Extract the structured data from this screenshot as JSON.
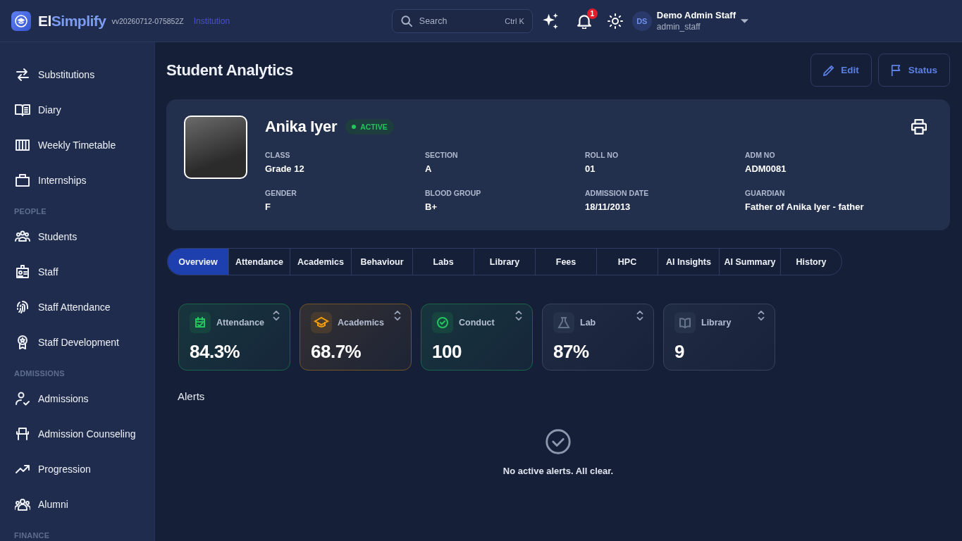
{
  "header": {
    "brand_lead": "El",
    "brand_rest": "Simplify",
    "version": "vv20260712-075852Z",
    "context": "Institution",
    "search": {
      "placeholder": "Search",
      "shortcut": "Ctrl K"
    },
    "notifications": {
      "count": "1"
    },
    "user": {
      "initials": "DS",
      "name": "Demo Admin Staff",
      "username": "admin_staff"
    }
  },
  "sidebar": {
    "sections": [
      {
        "items": [
          {
            "label": "Substitutions",
            "selected": false
          },
          {
            "label": "Diary",
            "selected": false
          },
          {
            "label": "Weekly Timetable",
            "selected": false
          },
          {
            "label": "Internships",
            "selected": false
          }
        ]
      },
      {
        "heading": "PEOPLE",
        "items": [
          {
            "label": "Students",
            "selected": false
          },
          {
            "label": "Staff",
            "selected": false
          },
          {
            "label": "Staff Attendance",
            "selected": false
          },
          {
            "label": "Staff Development",
            "selected": false
          }
        ]
      },
      {
        "heading": "ADMISSIONS",
        "items": [
          {
            "label": "Admissions",
            "selected": false
          },
          {
            "label": "Admission Counseling",
            "selected": false
          },
          {
            "label": "Progression",
            "selected": false
          },
          {
            "label": "Alumni",
            "selected": false
          }
        ]
      },
      {
        "heading": "FINANCE"
      }
    ]
  },
  "page": {
    "title": "Student Analytics",
    "actions": [
      {
        "label": "Edit"
      },
      {
        "label": "Status"
      }
    ]
  },
  "profile": {
    "name": "Anika Iyer",
    "status": {
      "label": "ACTIVE"
    },
    "fields": [
      {
        "label": "CLASS",
        "value": "Grade 12"
      },
      {
        "label": "SECTION",
        "value": "A"
      },
      {
        "label": "ROLL NO",
        "value": "01"
      },
      {
        "label": "ADM NO",
        "value": "ADM0081"
      },
      {
        "label": "GENDER",
        "value": "F"
      },
      {
        "label": "BLOOD GROUP",
        "value": "B+"
      },
      {
        "label": "ADMISSION DATE",
        "value": "18/11/2013"
      },
      {
        "label": "GUARDIAN",
        "value": "Father of Anika Iyer - father"
      }
    ]
  },
  "tabs": [
    {
      "label": "Overview",
      "selected": true
    },
    {
      "label": "Attendance",
      "selected": false
    },
    {
      "label": "Academics",
      "selected": false
    },
    {
      "label": "Behaviour",
      "selected": false
    },
    {
      "label": "Labs",
      "selected": false
    },
    {
      "label": "Library",
      "selected": false
    },
    {
      "label": "Fees",
      "selected": false
    },
    {
      "label": "HPC",
      "selected": false
    },
    {
      "label": "AI Insights",
      "selected": false
    },
    {
      "label": "AI Summary",
      "selected": false
    },
    {
      "label": "History",
      "selected": false
    }
  ],
  "stats": [
    {
      "label": "Attendance",
      "value": "84.3%",
      "color": "#22c55e"
    },
    {
      "label": "Academics",
      "value": "68.7%",
      "color": "#f59e0b"
    },
    {
      "label": "Conduct",
      "value": "100",
      "color": "#22c55e"
    },
    {
      "label": "Lab",
      "value": "87%",
      "color": "#64748b"
    },
    {
      "label": "Library",
      "value": "9",
      "color": "#64748b"
    }
  ],
  "alerts": {
    "title": "Alerts",
    "empty_message": "No active alerts. All clear."
  }
}
